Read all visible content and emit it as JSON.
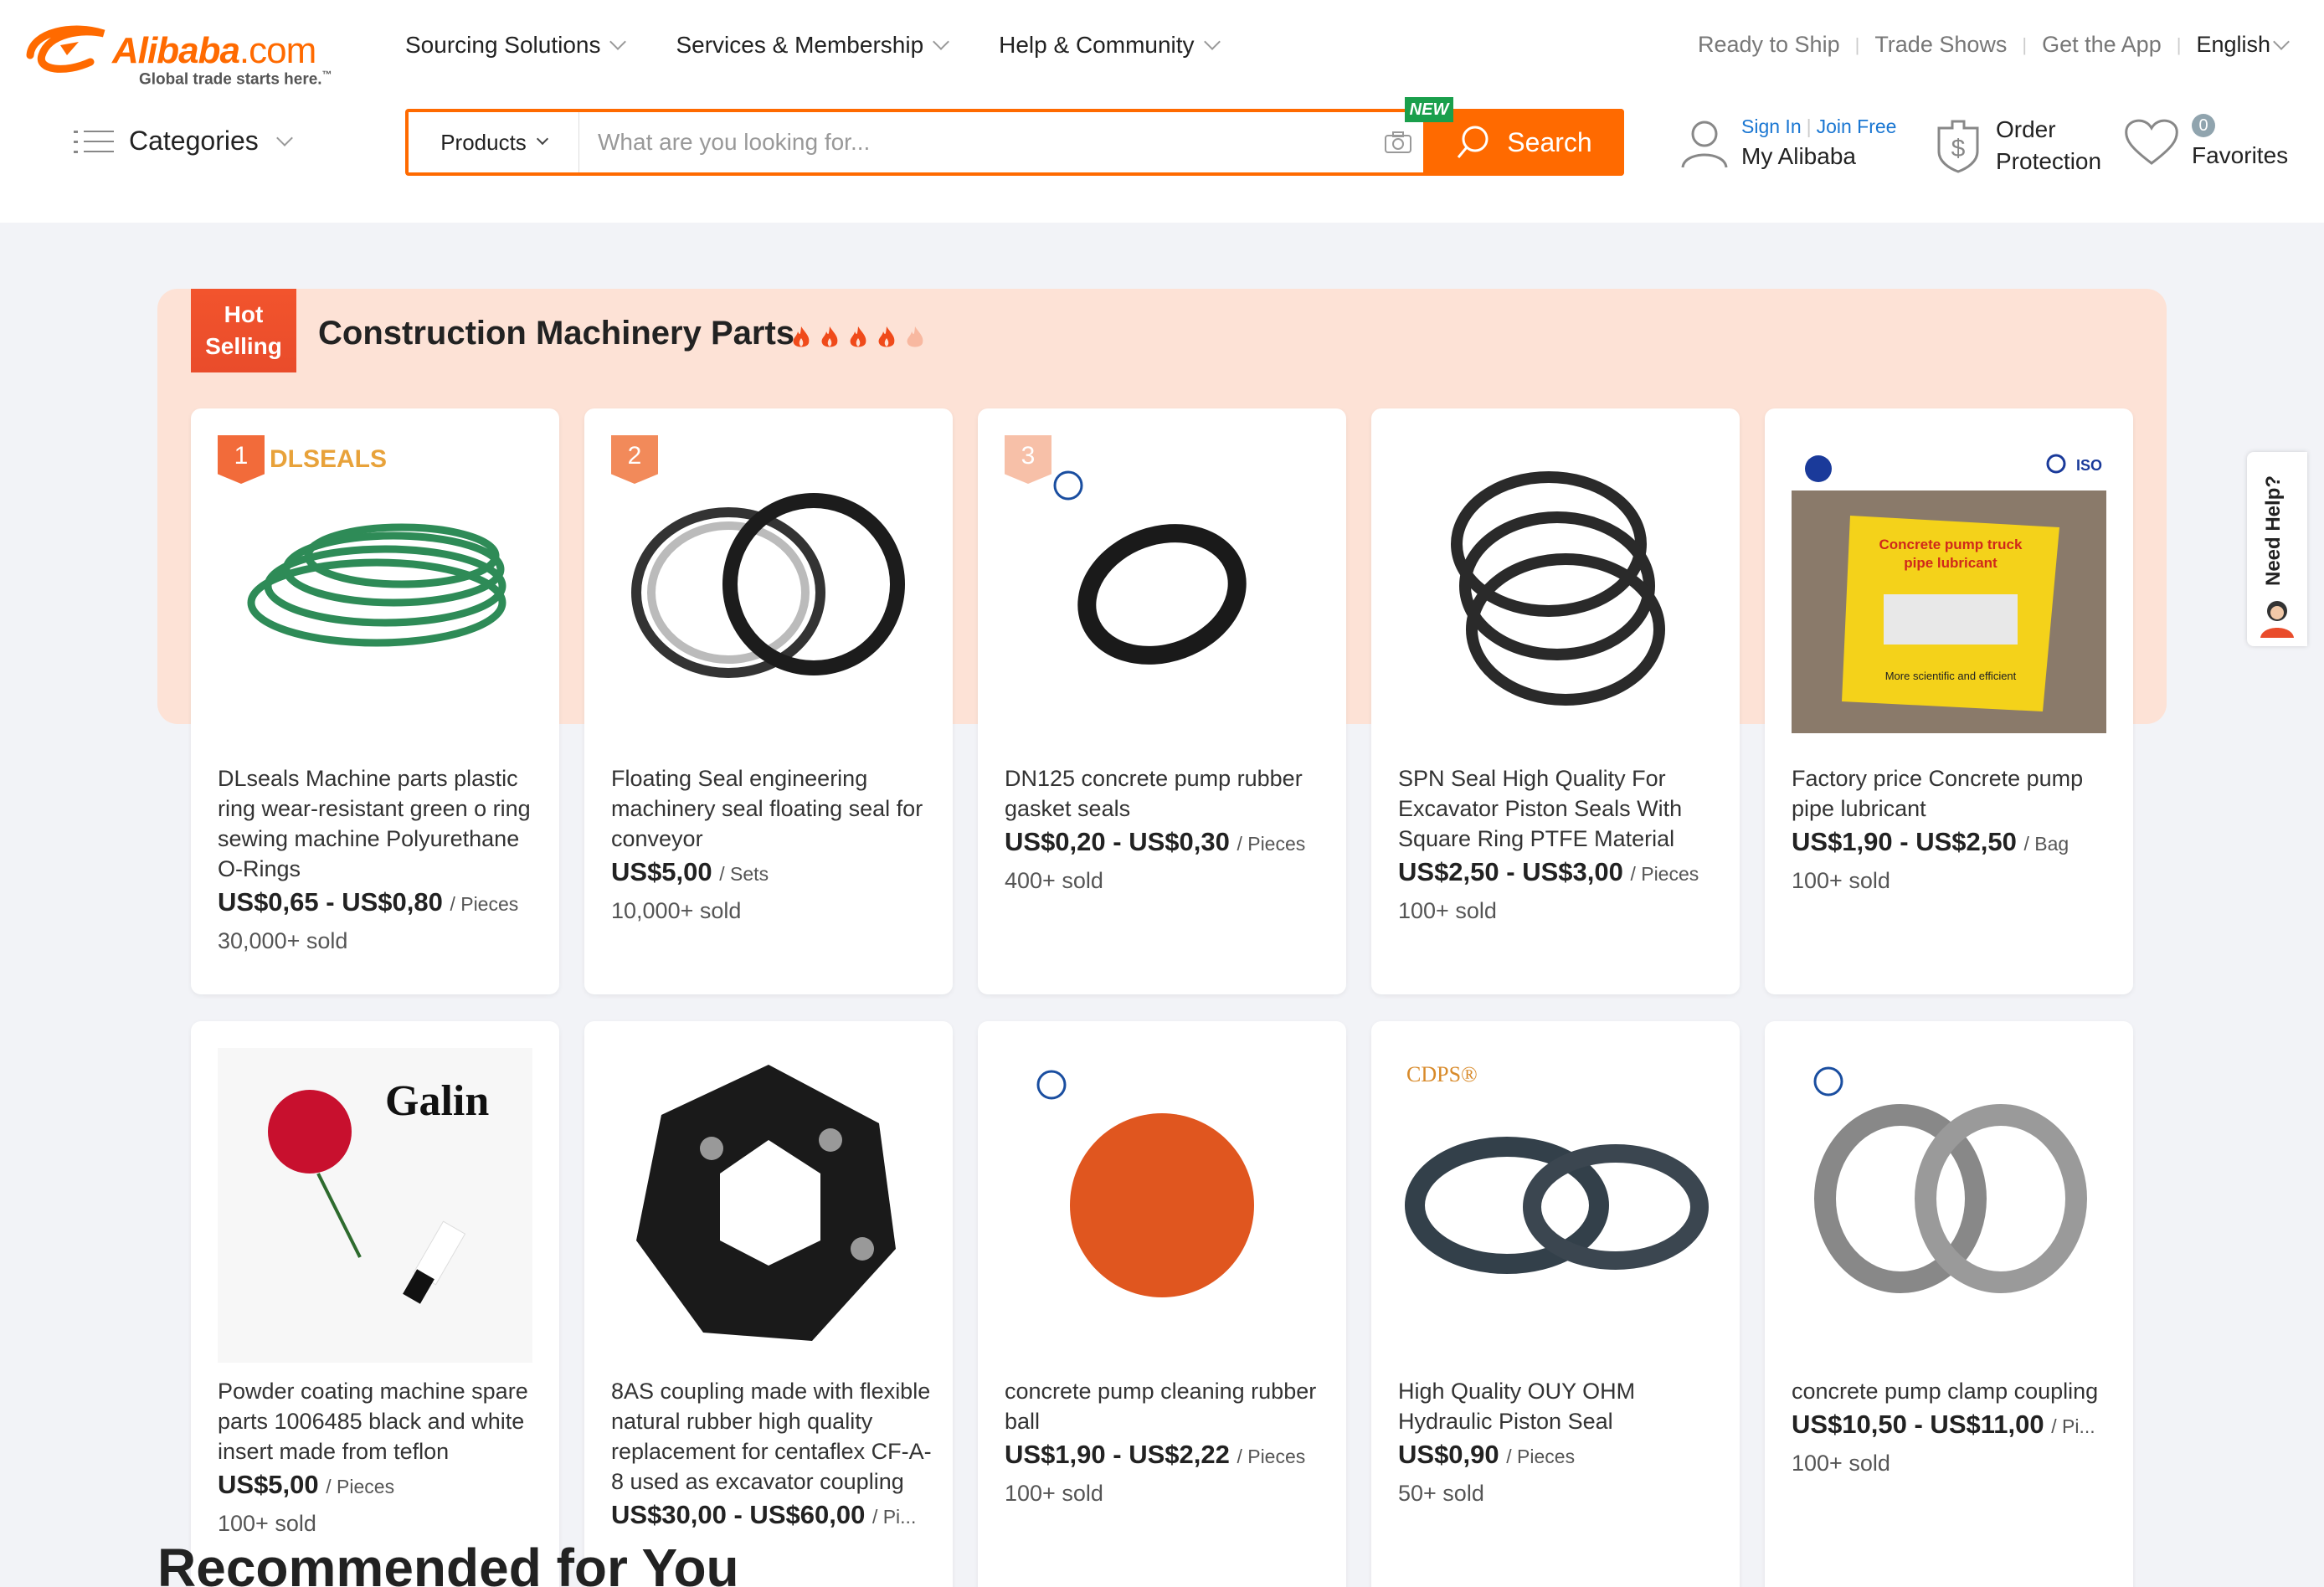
{
  "header": {
    "logo": {
      "brand": "Alibaba",
      "dotcom": ".com",
      "tagline": "Global trade starts here.",
      "tm": "™"
    },
    "nav": [
      {
        "label": "Sourcing Solutions"
      },
      {
        "label": "Services & Membership"
      },
      {
        "label": "Help & Community"
      }
    ],
    "right_nav": {
      "ready_to_ship": "Ready to Ship",
      "trade_shows": "Trade Shows",
      "get_app": "Get the App",
      "language": "English"
    },
    "categories_label": "Categories",
    "search": {
      "type": "Products",
      "placeholder": "What are you looking for...",
      "new_badge": "NEW",
      "button": "Search"
    },
    "account": {
      "sign_in": "Sign In",
      "join_free": "Join Free",
      "my_alibaba": "My Alibaba",
      "order_protection_1": "Order",
      "order_protection_2": "Protection",
      "favorites_count": "0",
      "favorites": "Favorites"
    }
  },
  "hot_selling": {
    "tag_line1": "Hot",
    "tag_line2": "Selling",
    "title": "Construction Machinery Parts",
    "products": [
      {
        "rank": "1",
        "title": "DLseals Machine parts plastic ring wear-resistant green o ring sewing machine Polyurethane O-Rings",
        "price": "US$0,65 - US$0,80",
        "unit": "/ Pieces",
        "sold": "30,000+ sold",
        "brand_text": "DLSEALS"
      },
      {
        "rank": "2",
        "title": "Floating Seal engineering machinery seal floating seal for conveyor",
        "price": "US$5,00",
        "unit": "/ Sets",
        "sold": "10,000+ sold"
      },
      {
        "rank": "3",
        "title": "DN125 concrete pump rubber gasket seals",
        "price": "US$0,20 - US$0,30",
        "unit": "/ Pieces",
        "sold": "400+ sold"
      },
      {
        "title": "SPN Seal High Quality For Excavator Piston Seals With Square Ring PTFE Material",
        "price": "US$2,50 - US$3,00",
        "unit": "/ Pieces",
        "sold": "100+ sold"
      },
      {
        "title": "Factory price Concrete pump pipe lubricant",
        "price": "US$1,90 - US$2,50",
        "unit": "/ Bag",
        "sold": "100+ sold",
        "bag_line1": "Concrete pump truck",
        "bag_line2": "pipe lubricant",
        "bag_line3": "More scientific and efficient",
        "iso": "ISO"
      },
      {
        "title": "Powder coating machine spare parts 1006485 black and white insert made from teflon",
        "price": "US$5,00",
        "unit": "/ Pieces",
        "sold": "100+ sold",
        "brand_text": "Galin"
      },
      {
        "title": "8AS coupling made with flexible natural rubber high quality replacement for centaflex CF-A-8 used as excavator coupling",
        "price": "US$30,00 - US$60,00",
        "unit": "/ Pi...",
        "sold": ""
      },
      {
        "title": "concrete pump cleaning rubber ball",
        "price": "US$1,90 - US$2,22",
        "unit": "/ Pieces",
        "sold": "100+ sold"
      },
      {
        "title": "High Quality OUY OHM Hydraulic Piston Seal",
        "price": "US$0,90",
        "unit": "/ Pieces",
        "sold": "50+ sold",
        "brand_text": "CDPS®"
      },
      {
        "title": "concrete pump clamp coupling",
        "price": "US$10,50 - US$11,00",
        "unit": "/ Pi...",
        "sold": "100+ sold"
      }
    ]
  },
  "need_help": "Need Help?",
  "recommended": "Recommended for You",
  "colors": {
    "accent": "#ff6a00",
    "panel_bg": "#fde2d6",
    "hot_red": "#f2542d",
    "link_blue": "#1976d2"
  }
}
